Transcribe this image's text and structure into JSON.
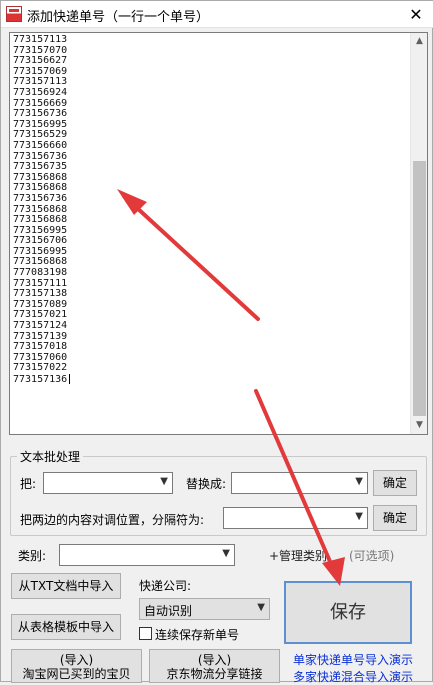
{
  "window": {
    "title": "添加快递单号（一行一个单号）",
    "close_glyph": "✕"
  },
  "list": {
    "lines": [
      "773157113",
      "773157070",
      "773156627",
      "773157069",
      "773157113",
      "773156924",
      "773156669",
      "773156736",
      "773156995",
      "773156529",
      "773156660",
      "773156736",
      "773156735",
      "773156868",
      "773156868",
      "773156736",
      "773156868",
      "773156868",
      "773156995",
      "773156706",
      "773156995",
      "773156868",
      "777083198",
      "773157111",
      "773157138",
      "773157089",
      "773157021",
      "773157124",
      "773157139",
      "773157018",
      "773157060",
      "773157022",
      "773157136"
    ]
  },
  "batch": {
    "group_label": "文本批处理",
    "replace_from_label": "把:",
    "replace_to_label": "替换成:",
    "confirm_label": "确定",
    "swap_label": "把两边的内容对调位置，分隔符为:",
    "swap_confirm_label": "确定"
  },
  "category": {
    "label": "类别:",
    "manage_label": "+管理类别",
    "optional_label": "(可选项)"
  },
  "import": {
    "txt_label": "从TXT文档中导入",
    "template_label": "从表格模板中导入",
    "taobao_line1": "(导入)",
    "taobao_line2": "淘宝网已买到的宝贝",
    "jd_line1": "(导入)",
    "jd_line2": "京东物流分享链接"
  },
  "courier": {
    "label": "快递公司:",
    "selected": "自动识别"
  },
  "continuous_save_label": "连续保存新单号",
  "save_label": "保存",
  "demo_links": {
    "single": "单家快递单号导入演示",
    "multi": "多家快递混合导入演示"
  },
  "colors": {
    "arrow": "#e23a3a",
    "link": "#0a2fd6",
    "focus": "#5d8fd1"
  }
}
